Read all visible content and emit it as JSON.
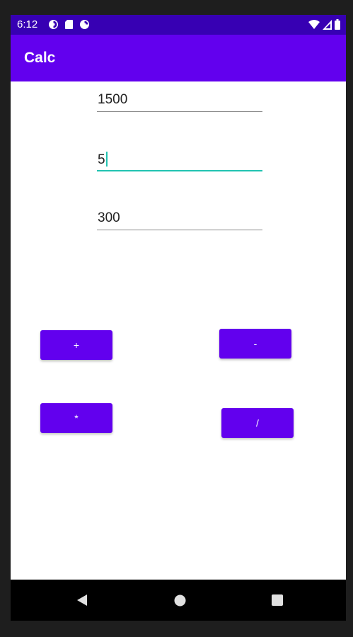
{
  "status_bar": {
    "time": "6:12",
    "left_icons": [
      "sync-icon",
      "sd-card-icon",
      "sync-icon"
    ],
    "right_icons": [
      "wifi-icon",
      "cell-signal-icon",
      "battery-icon"
    ]
  },
  "app_bar": {
    "title": "Calc"
  },
  "fields": {
    "first": {
      "value": "1500"
    },
    "second": {
      "value": "5"
    },
    "result": {
      "value": "300"
    }
  },
  "buttons": {
    "add": "+",
    "subtract": "-",
    "multiply": "*",
    "divide": "/"
  },
  "nav_bar": {
    "icons": [
      "back-icon",
      "home-icon",
      "recents-icon"
    ]
  },
  "colors": {
    "primary": "#6200ee",
    "primary_dark": "#3700b3",
    "accent": "#21c3b1"
  }
}
